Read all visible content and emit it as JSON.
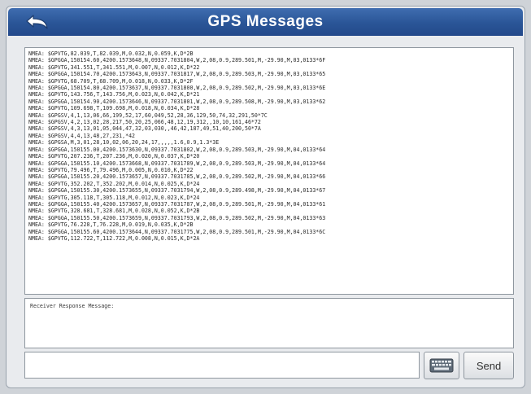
{
  "header": {
    "title": "GPS Messages",
    "back_icon": "back-arrow-icon"
  },
  "log": {
    "lines": [
      "NMEA: $GPVTG,82.039,T,82.039,M,0.032,N,0.059,K,D*2B",
      "NMEA: $GPGGA,150154.60,4200.1573648,N,09337.7031804,W,2,08,0.9,289.501,M,-29.90,M,03,0133*6F",
      "NMEA: $GPVTG,341.551,T,341.551,M,0.007,N,0.012,K,D*22",
      "NMEA: $GPGGA,150154.70,4200.1573643,N,09337.7031817,W,2,08,0.9,289.503,M,-29.90,M,03,0133*65",
      "NMEA: $GPVTG,68.709,T,68.709,M,0.018,N,0.033,K,D*2F",
      "NMEA: $GPGGA,150154.80,4200.1573637,N,09337.7031800,W,2,08,0.9,289.502,M,-29.90,M,03,0133*6E",
      "NMEA: $GPVTG,143.756,T,143.756,M,0.023,N,0.042,K,D*21",
      "NMEA: $GPGGA,150154.90,4200.1573646,N,09337.7031801,W,2,08,0.9,289.508,M,-29.90,M,03,0133*62",
      "NMEA: $GPVTG,109.698,T,109.698,M,0.018,N,0.034,K,D*28",
      "NMEA: $GPGSV,4,1,13,06,66,199,52,17,60,049,52,28,36,129,50,74,32,291,50*7C",
      "NMEA: $GPGSV,4,2,13,02,28,217,50,20,25,066,48,12,19,312,,10,10,161,46*72",
      "NMEA: $GPGSV,4,3,13,01,05,044,47,32,03,030,,46,42,187,49,51,40,200,50*7A",
      "NMEA: $GPGSV,4,4,13,48,27,231,*42",
      "NMEA: $GPGSA,M,3,01,28,10,02,06,20,24,17,,,,,1.6,0.9,1.3*3E",
      "NMEA: $GPGGA,150155.00,4200.1573630,N,09337.7031802,W,2,08,0.9,289.503,M,-29.90,M,04,0133*64",
      "NMEA: $GPVTG,207.236,T,207.236,M,0.020,N,0.037,K,D*20",
      "NMEA: $GPGGA,150155.10,4200.1573668,N,09337.7031789,W,2,08,0.9,289.503,M,-29.90,M,04,0133*64",
      "NMEA: $GPVTG,79.496,T,79.496,M,0.005,N,0.010,K,D*22",
      "NMEA: $GPGGA,150155.20,4200.1573657,N,09337.7031785,W,2,08,0.9,289.502,M,-29.90,M,04,0133*66",
      "NMEA: $GPVTG,352.202,T,352.202,M,0.014,N,0.025,K,D*24",
      "NMEA: $GPGGA,150155.30,4200.1573655,N,09337.7031794,W,2,08,0.9,289.498,M,-29.90,M,04,0133*67",
      "NMEA: $GPVTG,305.118,T,305.118,M,0.012,N,0.023,K,D*24",
      "NMEA: $GPGGA,150155.40,4200.1573657,N,09337.7031787,W,2,08,0.9,289.501,M,-29.90,M,04,0133*61",
      "NMEA: $GPVTG,328.681,T,328.681,M,0.028,N,0.052,K,D*2B",
      "NMEA: $GPGGA,150155.50,4200.1573659,N,09337.7031793,W,2,08,0.9,289.502,M,-29.90,M,04,0133*63",
      "NMEA: $GPVTG,76.228,T,76.228,M,0.019,N,0.035,K,D*2B",
      "NMEA: $GPGGA,150155.60,4200.1573644,N,09337.7031775,W,2,08,0.9,289.501,M,-29.90,M,04,0133*6C",
      "NMEA: $GPVTG,112.722,T,112.722,M,0.008,N,0.015,K,D*2A"
    ]
  },
  "response": {
    "label": "Receiver Response Message:"
  },
  "command": {
    "value": "",
    "placeholder": ""
  },
  "buttons": {
    "keyboard_icon": "keyboard-icon",
    "send_label": "Send"
  },
  "colors": {
    "header": "#2a5597",
    "header_text": "#ffffff"
  }
}
